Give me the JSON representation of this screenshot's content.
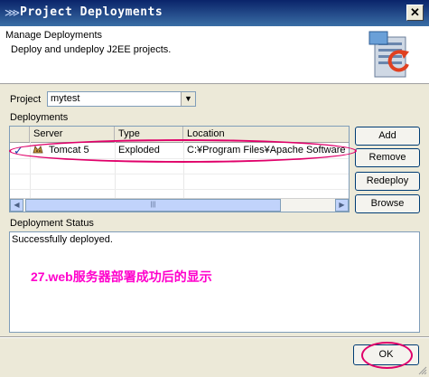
{
  "window": {
    "title": "Project Deployments",
    "close_glyph": "✕"
  },
  "header": {
    "title": "Manage Deployments",
    "subtitle": "Deploy and undeploy J2EE projects."
  },
  "project": {
    "label": "Project",
    "selected": "mytest"
  },
  "deployments": {
    "label": "Deployments",
    "columns": [
      "Server",
      "Type",
      "Location"
    ],
    "rows": [
      {
        "checked": true,
        "icon": "tomcat-icon",
        "server": "Tomcat 5",
        "type": "Exploded",
        "location": "C:¥Program Files¥Apache Software F"
      }
    ]
  },
  "buttons": {
    "add": "Add",
    "remove": "Remove",
    "redeploy": "Redeploy",
    "browse": "Browse"
  },
  "status": {
    "label": "Deployment Status",
    "text": "Successfully deployed."
  },
  "annotation": "27.web服务器部署成功后的显示",
  "footer": {
    "ok": "OK"
  },
  "colors": {
    "title_bar": "#0a246a",
    "annotation": "#ff00cc",
    "highlight_ring": "#e0006a"
  }
}
